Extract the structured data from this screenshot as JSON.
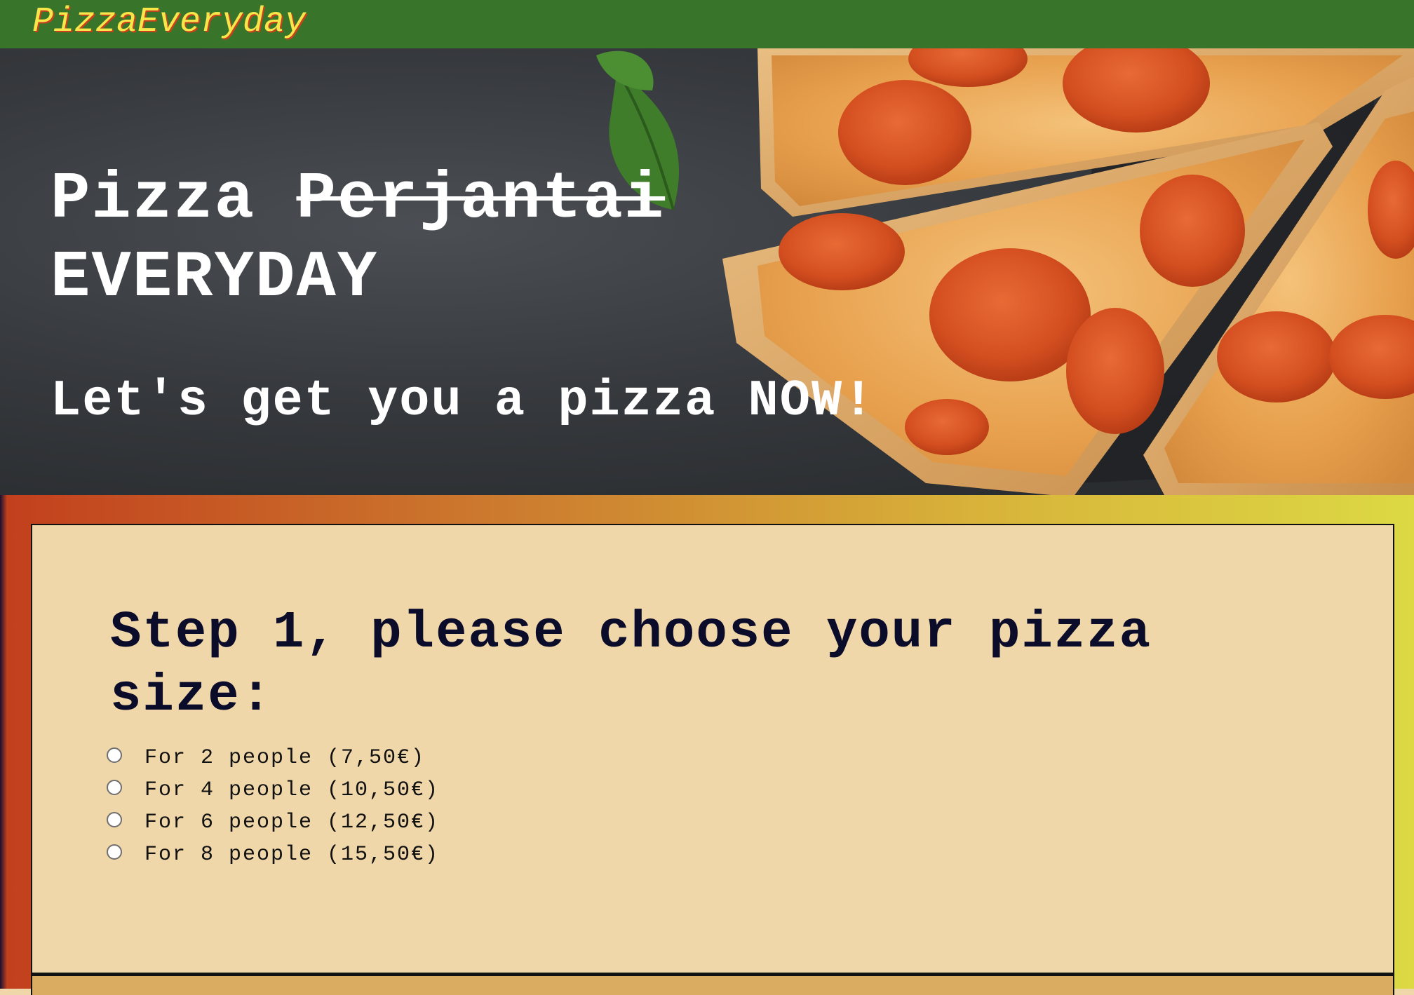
{
  "header": {
    "brand": "PizzaEveryday"
  },
  "hero": {
    "title_word": "Pizza",
    "title_struck": "Perjantai",
    "title_line2": "EVERYDAY",
    "subtitle": "Let's get you a pizza NOW!"
  },
  "step1": {
    "title": "Step 1, please choose your pizza size:",
    "options": [
      {
        "label": "For 2 people (7,50€)"
      },
      {
        "label": "For 4 people (10,50€)"
      },
      {
        "label": "For 6 people (12,50€)"
      },
      {
        "label": "For 8 people (15,50€)"
      }
    ]
  },
  "colors": {
    "header_bg": "#38752a",
    "brand_text": "#f6e64a",
    "brand_shadow": "#c23f1d",
    "card_bg": "#f0d7aa",
    "frame_gradient_start": "#c23f1d",
    "frame_gradient_end": "#dcd944"
  }
}
